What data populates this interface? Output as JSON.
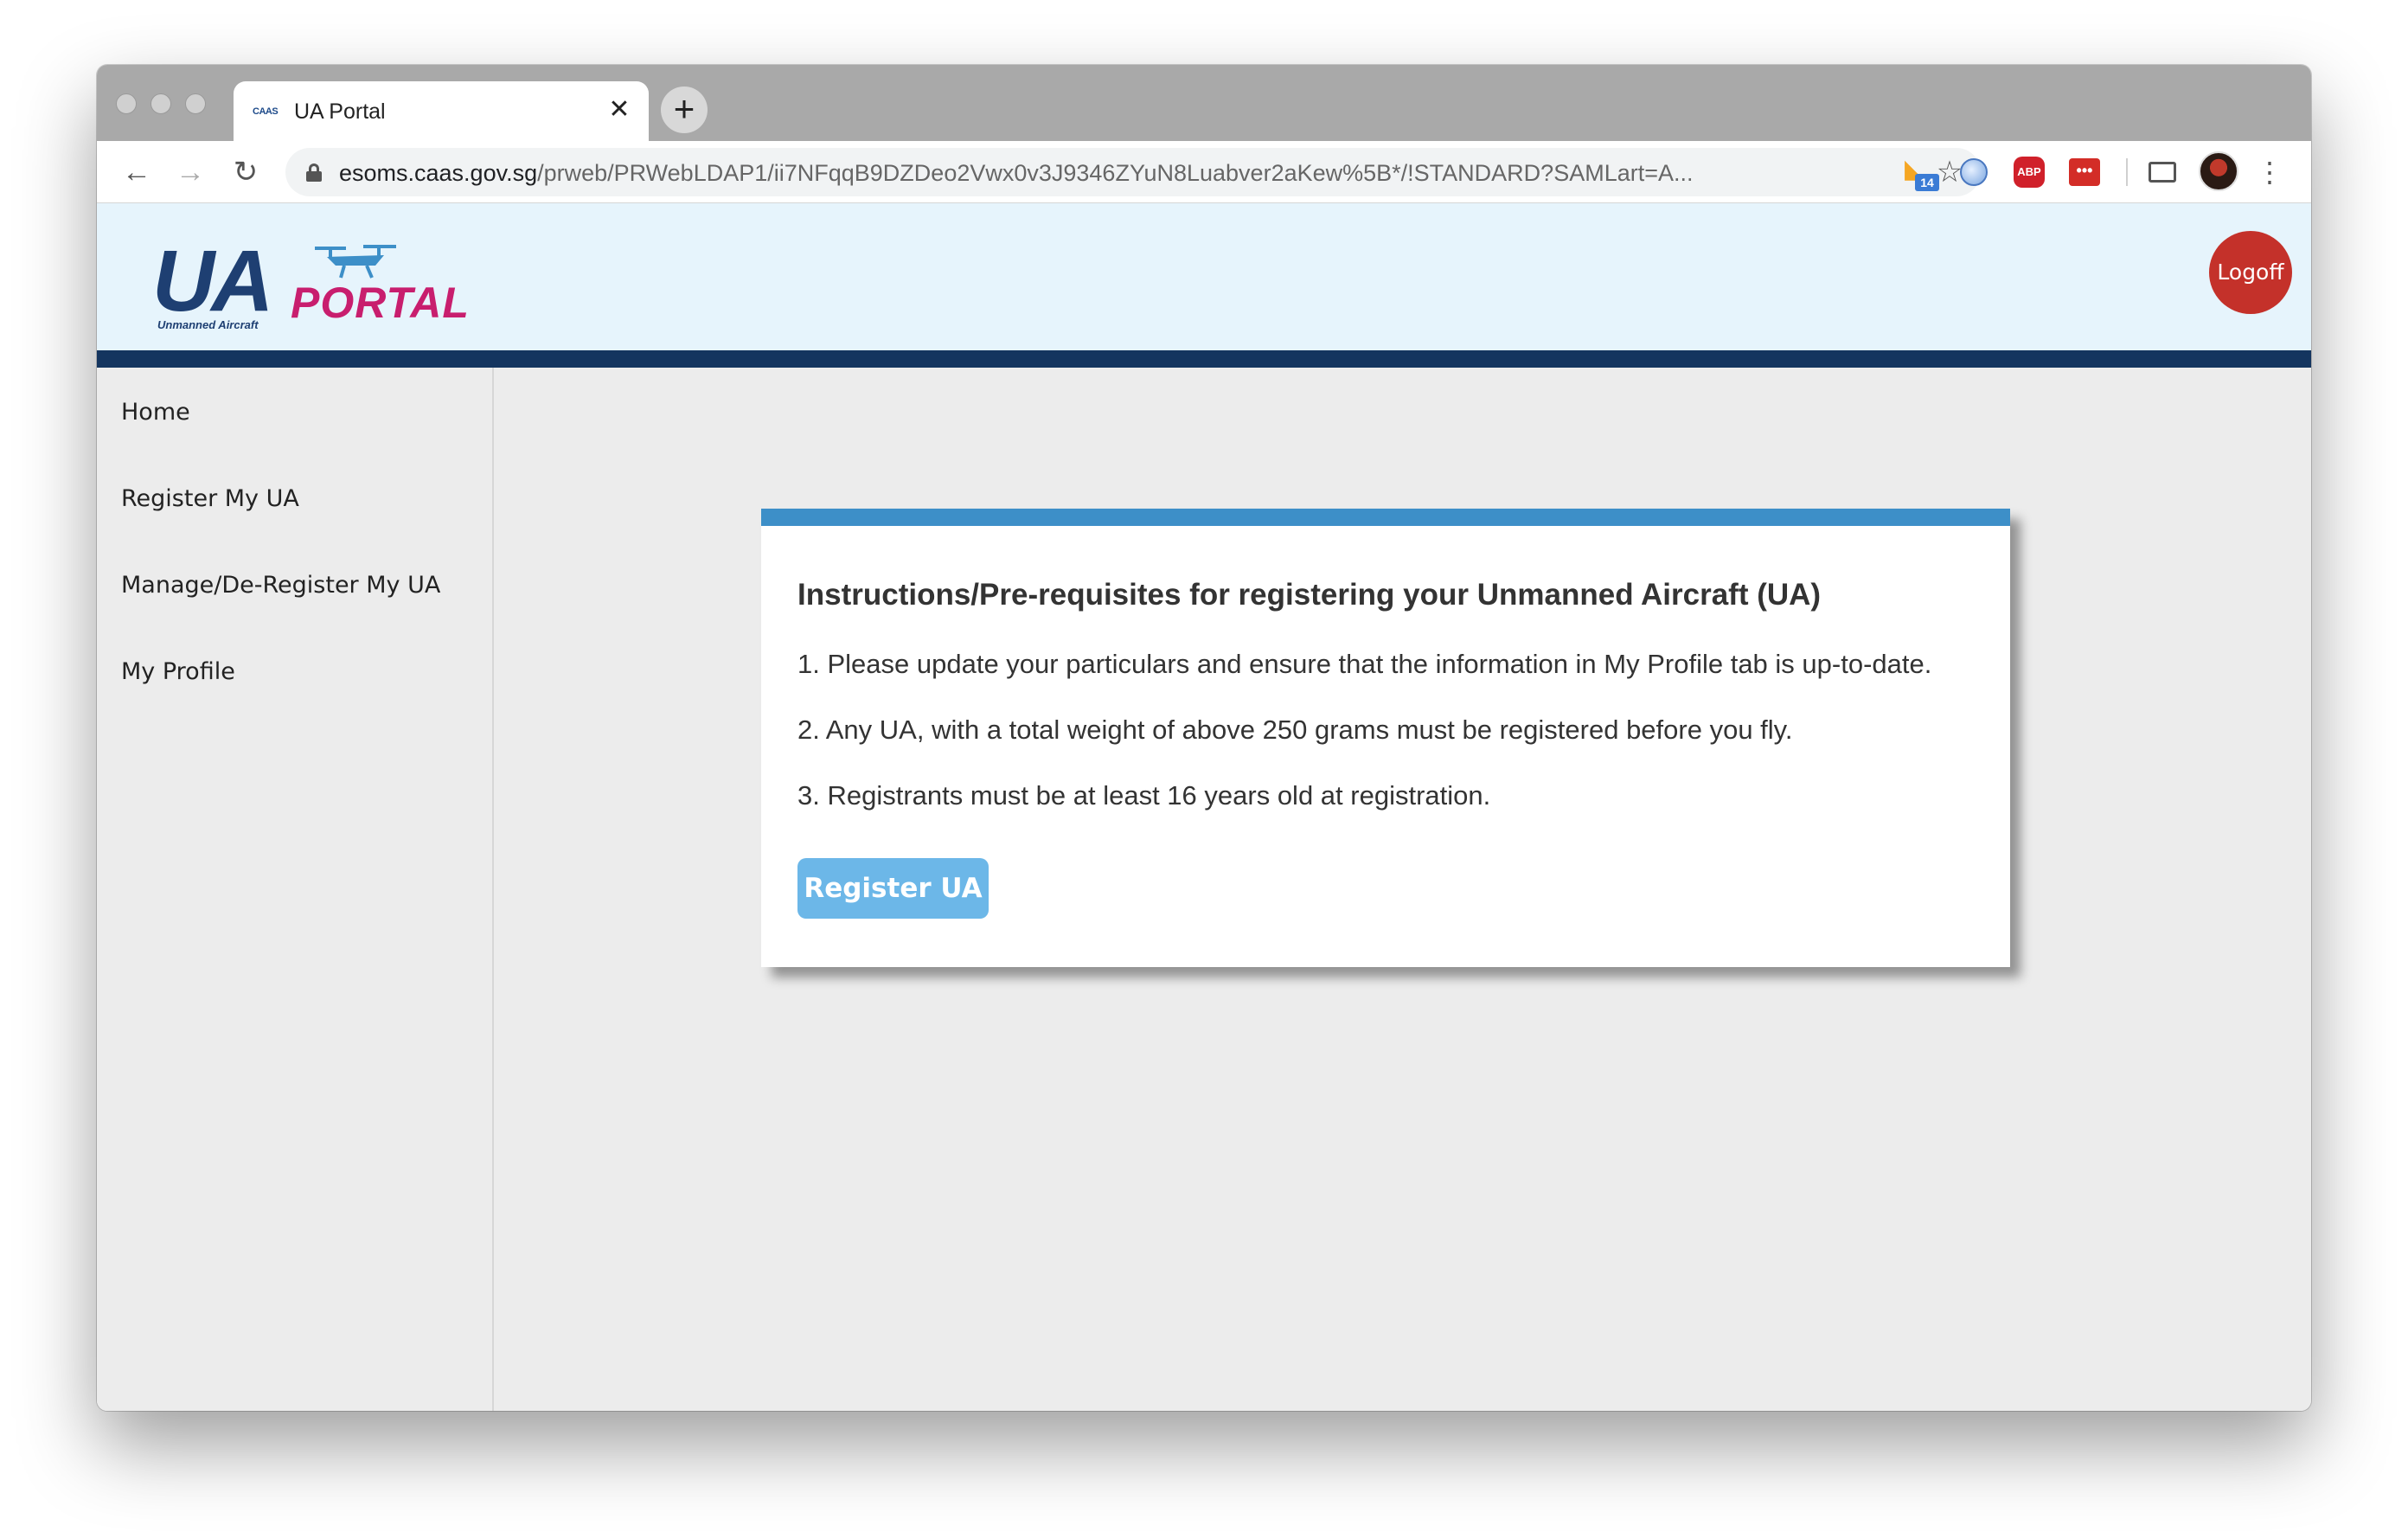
{
  "browser": {
    "tab": {
      "favicon_text": "CAAS",
      "title": "UA Portal",
      "close": "✕"
    },
    "new_tab": "+",
    "nav": {
      "back": "←",
      "forward": "→",
      "reload": "↻"
    },
    "url": {
      "domain": "esoms.caas.gov.sg",
      "path": "/prweb/PRWebLDAP1/ii7NFqqB9DZDeo2Vwx0v3J9346ZYuN8Luabver2aKew%5B*/!STANDARD?SAMLart=A..."
    },
    "bookmark_star": "☆",
    "extensions": {
      "rss_badge": "14",
      "abp_label": "ABP",
      "lastpass_label": "•••"
    },
    "menu": "⋮"
  },
  "header": {
    "logo": {
      "main": "UA",
      "portal": "PORTAL",
      "subtitle": "Unmanned Aircraft"
    },
    "logoff_label": "Logoff",
    "colors": {
      "header_bg": "#e6f4fc",
      "header_bar": "#14355f",
      "logoff": "#c4312a"
    }
  },
  "sidebar": {
    "items": [
      {
        "label": "Home"
      },
      {
        "label": "Register My UA"
      },
      {
        "label": "Manage/De-Register My UA"
      },
      {
        "label": "My Profile"
      }
    ]
  },
  "instructions": {
    "title": "Instructions/Pre-requisites for registering your Unmanned Aircraft (UA)",
    "lines": [
      "1. Please update your particulars and ensure that the information in My Profile tab is up-to-date.",
      "2. Any UA, with a total weight of above 250 grams must be registered before you fly.",
      "3. Registrants must be at least 16 years old at registration."
    ],
    "button_label": "Register UA",
    "colors": {
      "accent": "#3d8fc8",
      "button": "#6cb7e8"
    }
  }
}
